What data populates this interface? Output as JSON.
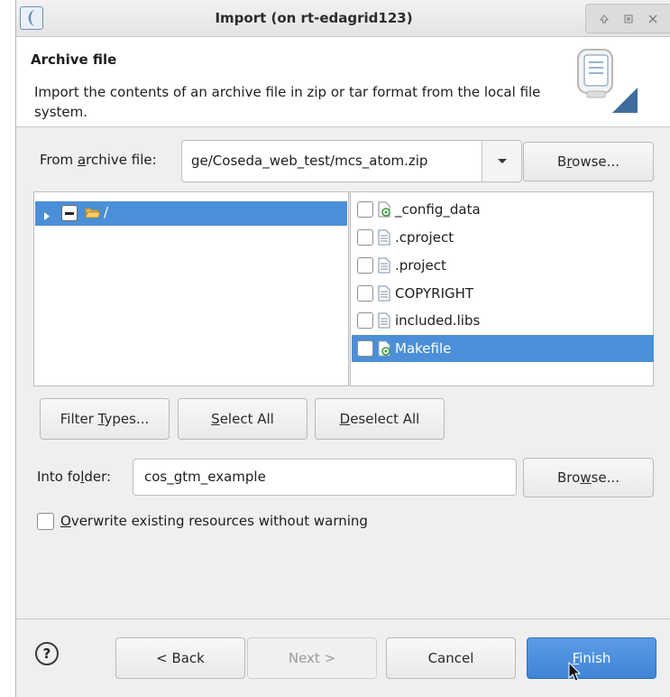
{
  "window": {
    "title": "Import  (on rt-edagrid123)"
  },
  "header": {
    "title": "Archive file",
    "description": "Import the contents of an archive file in zip or tar format from the local file system."
  },
  "archive": {
    "label_pre": "From ",
    "label_mnemonic": "a",
    "label_post": "rchive file:",
    "value": "ge/Coseda_web_test/mcs_atom.zip",
    "browse_pre": "B",
    "browse_mnemonic": "r",
    "browse_post": "owse..."
  },
  "tree": {
    "items": [
      {
        "label": "/"
      }
    ]
  },
  "files": [
    {
      "name": "_config_data",
      "icon": "folder-config-icon",
      "checked": false,
      "selected": false
    },
    {
      "name": ".cproject",
      "icon": "text-file-icon",
      "checked": false,
      "selected": false
    },
    {
      "name": ".project",
      "icon": "text-file-icon",
      "checked": false,
      "selected": false
    },
    {
      "name": "COPYRIGHT",
      "icon": "text-file-icon",
      "checked": false,
      "selected": false
    },
    {
      "name": "included.libs",
      "icon": "text-file-icon",
      "checked": false,
      "selected": false
    },
    {
      "name": "Makefile",
      "icon": "makefile-icon",
      "checked": false,
      "selected": true
    }
  ],
  "actions": {
    "filter_pre": "Filter ",
    "filter_mnemonic": "T",
    "filter_post": "ypes...",
    "select_mnemonic": "S",
    "select_post": "elect All",
    "deselect_mnemonic": "D",
    "deselect_post": "eselect All"
  },
  "into": {
    "label_pre": "Into fo",
    "label_mnemonic": "l",
    "label_post": "der:",
    "value": "cos_gtm_example",
    "browse_pre": "Bro",
    "browse_mnemonic": "w",
    "browse_post": "se..."
  },
  "overwrite": {
    "mnemonic": "O",
    "label_post": "verwrite existing resources without warning",
    "checked": false
  },
  "footer": {
    "help": "?",
    "back": "< Back",
    "next": "Next >",
    "cancel": "Cancel",
    "finish_mnemonic": "F",
    "finish_post": "inish"
  },
  "colors": {
    "selection": "#4a8fd8",
    "primary": "#3f84d6"
  }
}
